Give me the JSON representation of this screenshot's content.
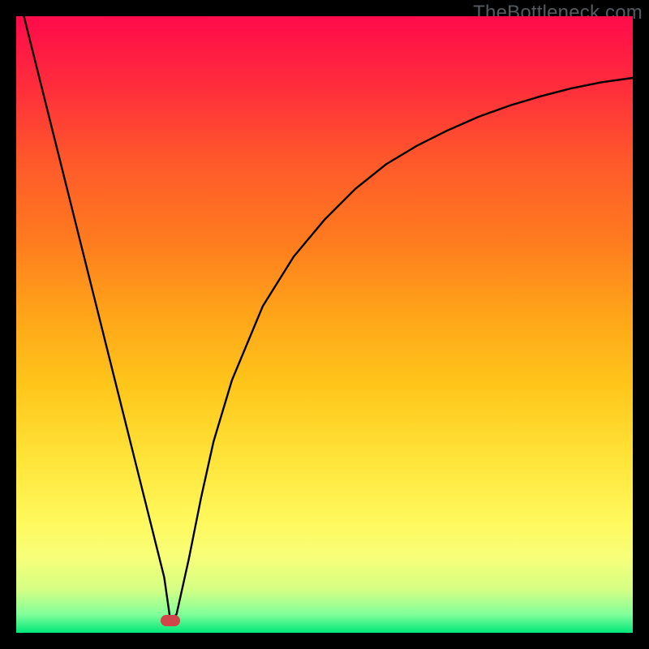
{
  "watermark": "TheBottleneck.com",
  "chart_data": {
    "type": "line",
    "title": "",
    "xlabel": "",
    "ylabel": "",
    "x": [
      0,
      2,
      4,
      6,
      8,
      10,
      12,
      14,
      16,
      18,
      20,
      22,
      24,
      25,
      26,
      28,
      30,
      32,
      35,
      40,
      45,
      50,
      55,
      60,
      65,
      70,
      75,
      80,
      85,
      90,
      95,
      100
    ],
    "values": [
      105,
      97,
      89,
      81,
      73,
      65,
      57,
      49,
      41,
      33,
      25,
      17,
      9,
      2,
      3,
      12,
      22,
      31,
      41,
      53,
      61,
      67,
      72,
      76,
      79,
      81.5,
      83.7,
      85.5,
      87,
      88.3,
      89.3,
      90
    ],
    "xlim": [
      0,
      100
    ],
    "ylim": [
      0,
      100
    ],
    "marker": {
      "x": 25,
      "y": 2
    },
    "gradient_stops": [
      {
        "pos": 0,
        "color": "#ff0a4a"
      },
      {
        "pos": 50,
        "color": "#ffb81c"
      },
      {
        "pos": 80,
        "color": "#fff95d"
      },
      {
        "pos": 100,
        "color": "#00e77a"
      }
    ]
  }
}
